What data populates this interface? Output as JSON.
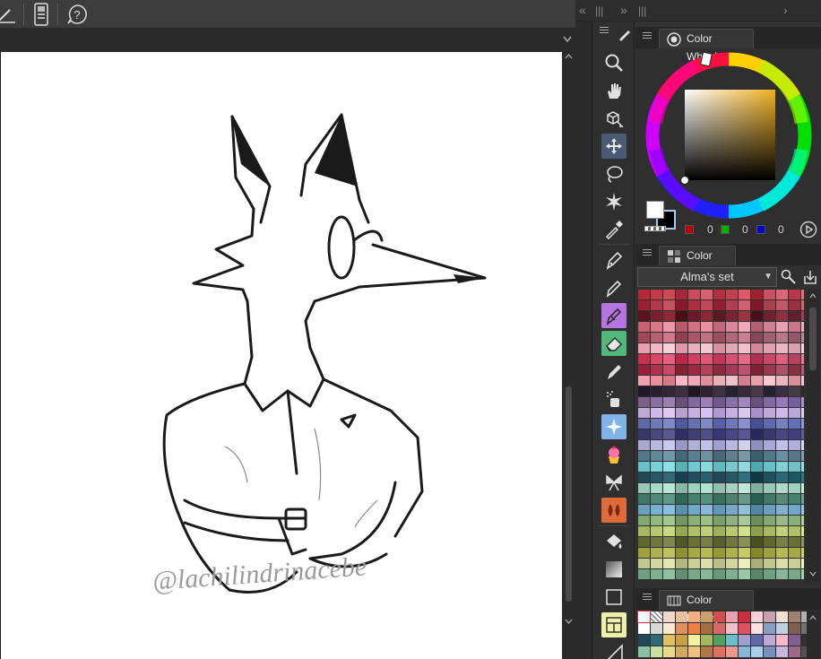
{
  "window": {
    "canvas_watermark": "@lachilindrinacebe"
  },
  "dock": {
    "left_collapse": "«",
    "grip1": "|||",
    "right_collapse": "»",
    "grip2": "|||",
    "expand": "›"
  },
  "color_wheel": {
    "tab_label": "Color Wheel",
    "main_color": "#ffffff",
    "sub_color": "#000000",
    "r": "0",
    "g": "0",
    "b": "0"
  },
  "color_set": {
    "tab_label": "Color Set",
    "selected_set": "Alma's set"
  },
  "color_history": {
    "tab_label": "Color History"
  },
  "tools": [
    {
      "name": "zoom-icon",
      "active": false
    },
    {
      "name": "hand-icon",
      "active": false
    },
    {
      "name": "operation-icon",
      "active": false
    },
    {
      "name": "move-layer-icon",
      "active": true
    },
    {
      "name": "lasso-icon",
      "active": false
    },
    {
      "name": "auto-select-icon",
      "active": false
    },
    {
      "name": "eyedropper-icon",
      "active": false
    },
    {
      "name": "pen-icon",
      "active": false
    },
    {
      "name": "pencil-icon",
      "active": false
    },
    {
      "name": "brush-icon",
      "active": false
    },
    {
      "name": "eraser-icon",
      "active": false
    },
    {
      "name": "airbrush-icon",
      "active": false
    },
    {
      "name": "spray-icon",
      "active": false
    },
    {
      "name": "decoration-icon",
      "active": false
    },
    {
      "name": "cupcake-icon",
      "active": false
    },
    {
      "name": "ribbon-icon",
      "active": false
    },
    {
      "name": "blend-icon",
      "active": false
    },
    {
      "name": "fill-icon",
      "active": false
    },
    {
      "name": "gradient-icon",
      "active": false
    },
    {
      "name": "figure-icon",
      "active": false
    },
    {
      "name": "frame-border-icon",
      "active": false
    },
    {
      "name": "ruler-icon",
      "active": false
    }
  ]
}
